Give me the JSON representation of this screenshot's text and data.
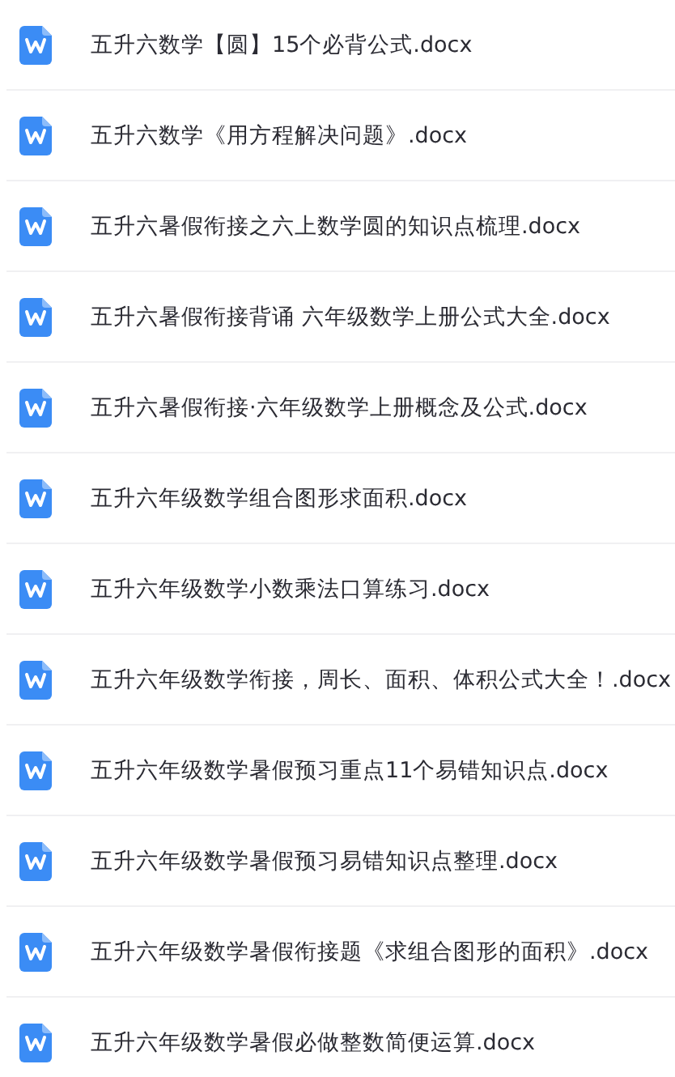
{
  "files": [
    {
      "name": "五升六数学【圆】15个必背公式.docx"
    },
    {
      "name": "五升六数学《用方程解决问题》.docx"
    },
    {
      "name": "五升六暑假衔接之六上数学圆的知识点梳理.docx"
    },
    {
      "name": "五升六暑假衔接背诵 六年级数学上册公式大全.docx"
    },
    {
      "name": "五升六暑假衔接·六年级数学上册概念及公式.docx"
    },
    {
      "name": "五升六年级数学组合图形求面积.docx"
    },
    {
      "name": "五升六年级数学小数乘法口算练习.docx"
    },
    {
      "name": "五升六年级数学衔接，周长、面积、体积公式大全！.docx"
    },
    {
      "name": "五升六年级数学暑假预习重点11个易错知识点.docx"
    },
    {
      "name": "五升六年级数学暑假预习易错知识点整理.docx"
    },
    {
      "name": "五升六年级数学暑假衔接题《求组合图形的面积》.docx"
    },
    {
      "name": "五升六年级数学暑假必做整数简便运算.docx"
    }
  ]
}
